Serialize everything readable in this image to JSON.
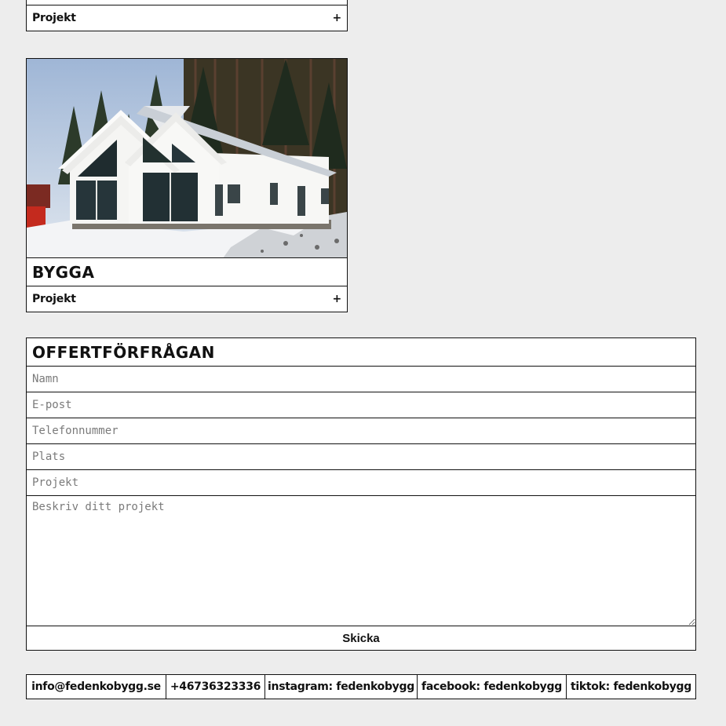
{
  "cards": [
    {
      "link_label": "Projekt",
      "expand_symbol": "+"
    },
    {
      "title": "BYGGA",
      "link_label": "Projekt",
      "expand_symbol": "+",
      "image_alt": "white house with large gable windows in snowy forest"
    }
  ],
  "form": {
    "title": "OFFERTFÖRFRÅGAN",
    "fields": {
      "name": "Namn",
      "email": "E-post",
      "phone": "Telefonnummer",
      "place": "Plats",
      "project": "Projekt",
      "description": "Beskriv ditt projekt"
    },
    "submit_label": "Skicka"
  },
  "footer": {
    "email": "info@fedenkobygg.se",
    "phone": "+46736323336",
    "instagram": "instagram: fedenkobygg",
    "facebook": "facebook: fedenkobygg",
    "tiktok": "tiktok: fedenkobygg"
  },
  "colors": {
    "background": "#ededed",
    "border": "#111111",
    "placeholder": "#7a7a7a"
  }
}
